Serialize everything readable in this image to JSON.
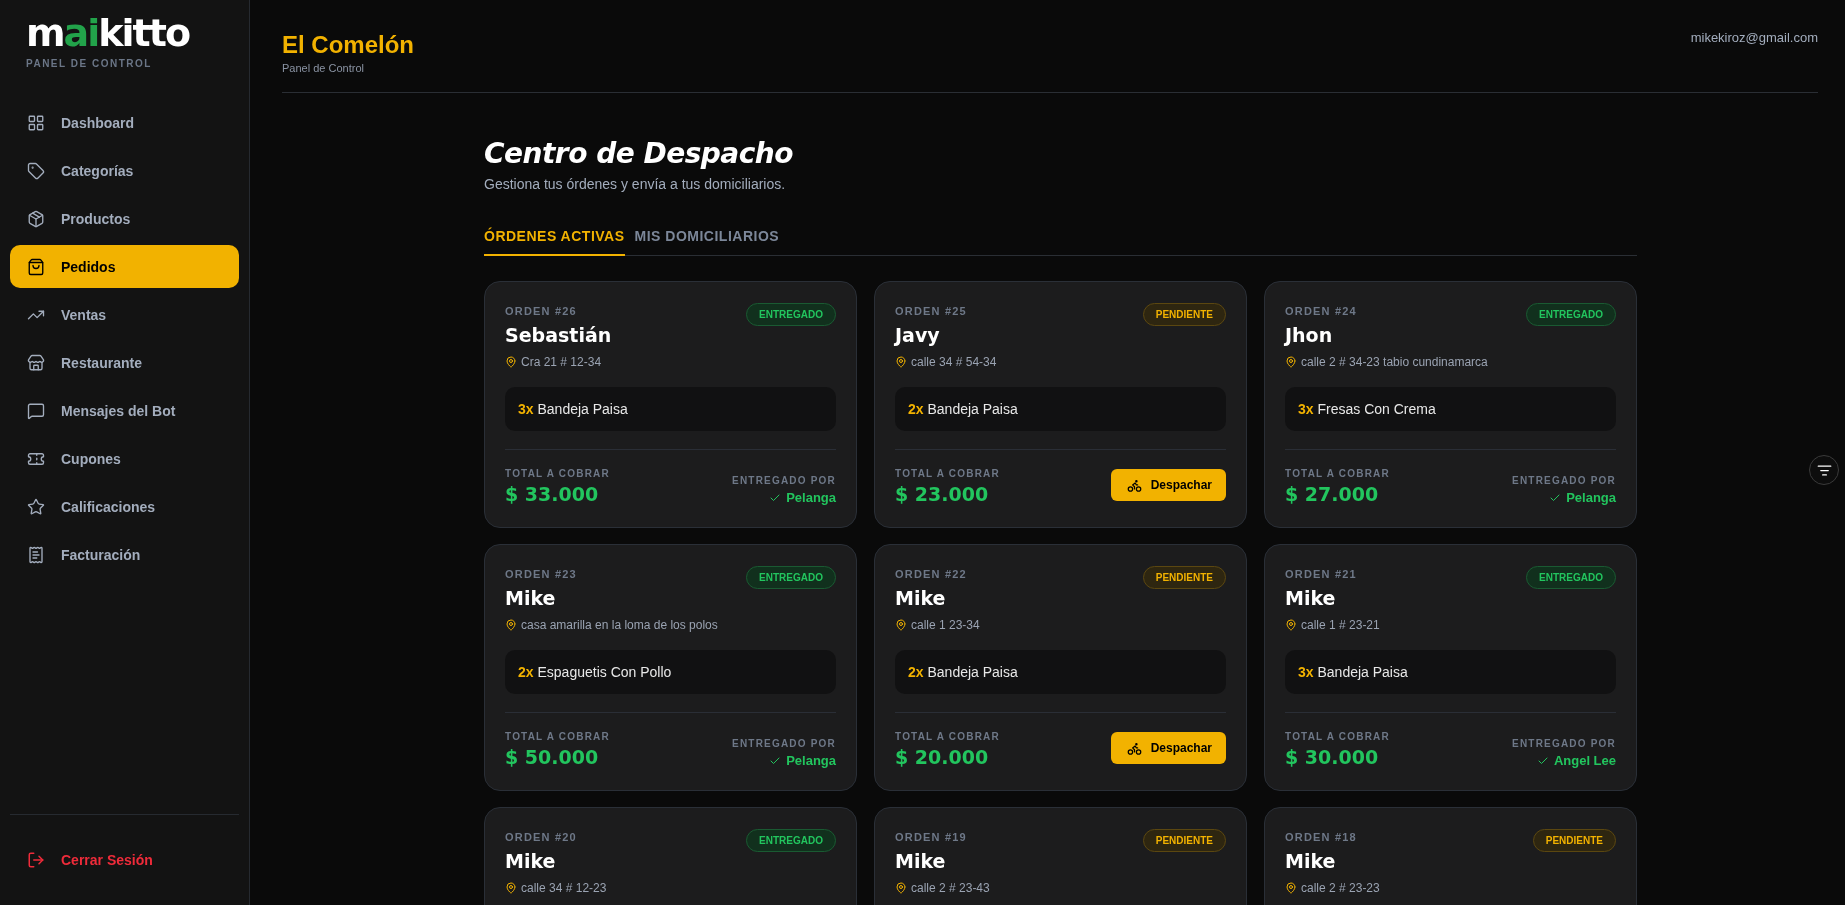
{
  "sidebar": {
    "logo": [
      {
        "text": "m",
        "accent": false
      },
      {
        "text": "ai",
        "accent": true
      },
      {
        "text": "kitto",
        "accent": false
      }
    ],
    "subtitle": "PANEL DE CONTROL",
    "items": [
      {
        "label": "Dashboard",
        "selected": false
      },
      {
        "label": "Categorías",
        "selected": false
      },
      {
        "label": "Productos",
        "selected": false
      },
      {
        "label": "Pedidos",
        "selected": true
      },
      {
        "label": "Ventas",
        "selected": false
      },
      {
        "label": "Restaurante",
        "selected": false
      },
      {
        "label": "Mensajes del Bot",
        "selected": false
      },
      {
        "label": "Cupones",
        "selected": false
      },
      {
        "label": "Calificaciones",
        "selected": false
      },
      {
        "label": "Facturación",
        "selected": false
      }
    ],
    "logout": "Cerrar Sesión"
  },
  "header": {
    "title": "El Comelón",
    "subtitle": "Panel de Control",
    "email": "mikekiroz@gmail.com"
  },
  "page": {
    "title": "Centro de Despacho",
    "subtitle": "Gestiona tus órdenes y envía a tus domiciliarios."
  },
  "tabs": [
    {
      "label": "ÓRDENES ACTIVAS",
      "selected": true
    },
    {
      "label": "MIS DOMICILIARIOS",
      "selected": false
    }
  ],
  "orders": [
    {
      "order": "ORDEN #26",
      "kind": "delivered",
      "badge": "ENTREGADO",
      "name": "Sebastián",
      "address": "Cra 21 # 12-34",
      "items": [
        {
          "qty": "3x",
          "product": "Bandeja Paisa"
        }
      ],
      "total_label": "TOTAL A COBRAR",
      "total": "$ 33.000",
      "delivered_label": "ENTREGADO POR",
      "courier": "Pelanga"
    },
    {
      "order": "ORDEN #25",
      "kind": "pending",
      "badge": "PENDIENTE",
      "name": "Javy",
      "address": "calle 34 # 54-34",
      "items": [
        {
          "qty": "2x",
          "product": "Bandeja Paisa"
        }
      ],
      "total_label": "TOTAL A COBRAR",
      "total": "$ 23.000",
      "button": "Despachar"
    },
    {
      "order": "ORDEN #24",
      "kind": "delivered",
      "badge": "ENTREGADO",
      "name": "Jhon",
      "address": "calle 2 # 34-23 tabio cundinamarca",
      "items": [
        {
          "qty": "3x",
          "product": "Fresas Con Crema"
        }
      ],
      "total_label": "TOTAL A COBRAR",
      "total": "$ 27.000",
      "delivered_label": "ENTREGADO POR",
      "courier": "Pelanga"
    },
    {
      "order": "ORDEN #23",
      "kind": "delivered",
      "badge": "ENTREGADO",
      "name": "Mike",
      "address": "casa amarilla en la loma de los polos",
      "items": [
        {
          "qty": "2x",
          "product": "Espaguetis Con Pollo"
        }
      ],
      "total_label": "TOTAL A COBRAR",
      "total": "$ 50.000",
      "delivered_label": "ENTREGADO POR",
      "courier": "Pelanga"
    },
    {
      "order": "ORDEN #22",
      "kind": "pending",
      "badge": "PENDIENTE",
      "name": "Mike",
      "address": "calle 1 23-34",
      "items": [
        {
          "qty": "2x",
          "product": "Bandeja Paisa"
        }
      ],
      "total_label": "TOTAL A COBRAR",
      "total": "$ 20.000",
      "button": "Despachar"
    },
    {
      "order": "ORDEN #21",
      "kind": "delivered",
      "badge": "ENTREGADO",
      "name": "Mike",
      "address": "calle 1 # 23-21",
      "items": [
        {
          "qty": "3x",
          "product": "Bandeja Paisa"
        }
      ],
      "total_label": "TOTAL A COBRAR",
      "total": "$ 30.000",
      "delivered_label": "ENTREGADO POR",
      "courier": "Angel Lee"
    },
    {
      "order": "ORDEN #20",
      "kind": "delivered",
      "badge": "ENTREGADO",
      "name": "Mike",
      "address": "calle 34 # 12-23"
    },
    {
      "order": "ORDEN #19",
      "kind": "pending",
      "badge": "PENDIENTE",
      "name": "Mike",
      "address": "calle 2 # 23-43"
    },
    {
      "order": "ORDEN #18",
      "kind": "pending",
      "badge": "PENDIENTE",
      "name": "Mike",
      "address": "calle 2 # 23-23"
    }
  ]
}
